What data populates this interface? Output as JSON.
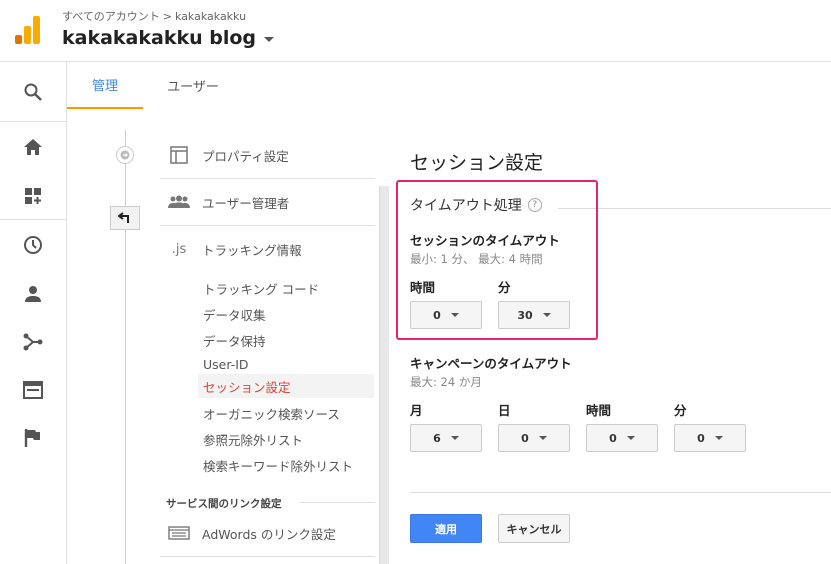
{
  "header": {
    "breadcrumb_root": "すべてのアカウント",
    "breadcrumb_sep": ">",
    "breadcrumb_account": "kakakakakku",
    "account_title": "kakakakakku blog"
  },
  "leftnav": {
    "icons": [
      "search-icon",
      "home-icon",
      "dashboard-add-icon",
      "clock-icon",
      "person-icon",
      "share-flow-icon",
      "browser-window-icon",
      "flag-icon"
    ]
  },
  "tabs": {
    "admin": "管理",
    "users": "ユーザー"
  },
  "menu": {
    "property_settings": "プロパティ設定",
    "user_management": "ユーザー管理者",
    "tracking_info": "トラッキング情報",
    "js_icon_text": ".js",
    "sub_items": [
      "トラッキング コード",
      "データ収集",
      "データ保持",
      "User-ID",
      "セッション設定",
      "オーガニック検索ソース",
      "参照元除外リスト",
      "検索キーワード除外リスト"
    ],
    "section_label": "サービス間のリンク設定",
    "adwords_link": "AdWords のリンク設定"
  },
  "content": {
    "page_title": "セッション設定",
    "timeout_section": "タイムアウト処理",
    "help": "?",
    "session_timeout_label": "セッションのタイムアウト",
    "session_timeout_hint": "最小: 1 分、 最大: 4 時間",
    "hours_label": "時間",
    "minutes_label": "分",
    "session_hours_value": "0",
    "session_minutes_value": "30",
    "campaign_timeout_label": "キャンペーンのタイムアウト",
    "campaign_timeout_hint": "最大: 24 か月",
    "months_label": "月",
    "days_label": "日",
    "campaign_hours_label": "時間",
    "campaign_minutes_label": "分",
    "campaign_months_value": "6",
    "campaign_days_value": "0",
    "campaign_hours_value": "0",
    "campaign_minutes_value": "0",
    "apply_button": "適用",
    "cancel_button": "キャンセル"
  },
  "colors": {
    "accent_blue": "#4285f4",
    "tab_underline": "#ff9800",
    "active_red": "#db4437",
    "highlight_pink": "#e8246d",
    "logo_orange": "#f9ab00",
    "logo_dark_orange": "#e37400"
  }
}
